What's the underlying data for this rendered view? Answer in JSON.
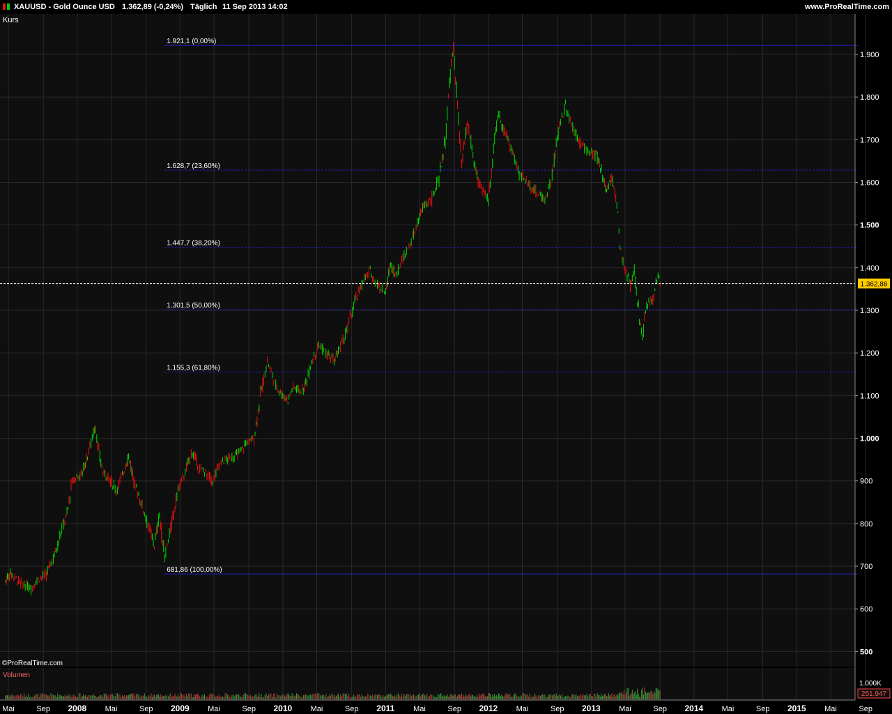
{
  "header": {
    "symbol": "XAUUSD - Gold Ounce USD",
    "quote": "1.362,89 (-0,24%)",
    "period": "Täglich",
    "datetime": "11 Sep 2013 14:02",
    "site": "www.ProRealTime.com"
  },
  "panels": {
    "price_label": "Kurs",
    "watermark": "©ProRealTime.com",
    "volume_label": "Volumen"
  },
  "current_price": {
    "value": 1362.86,
    "label": "1.362,86"
  },
  "colors": {
    "up": "#00dd00",
    "down": "#ee1111",
    "fib": "#2222cc",
    "bg": "#0f0f0f",
    "grid": "#2a2a2a",
    "current_bg": "#ffcc00"
  },
  "chart_data": [
    {
      "type": "line",
      "y_ticks": [
        {
          "v": 500,
          "label": "500"
        },
        {
          "v": 600,
          "label": "600"
        },
        {
          "v": 700,
          "label": "700"
        },
        {
          "v": 800,
          "label": "800"
        },
        {
          "v": 900,
          "label": "900"
        },
        {
          "v": 1000,
          "label": "1.000"
        },
        {
          "v": 1100,
          "label": "1.100"
        },
        {
          "v": 1200,
          "label": "1.200"
        },
        {
          "v": 1300,
          "label": "1.300"
        },
        {
          "v": 1400,
          "label": "1.400"
        },
        {
          "v": 1500,
          "label": "1.500"
        },
        {
          "v": 1600,
          "label": "1.600"
        },
        {
          "v": 1700,
          "label": "1.700"
        },
        {
          "v": 1800,
          "label": "1.800"
        },
        {
          "v": 1900,
          "label": "1.900"
        }
      ],
      "x_ticks": [
        {
          "t": 2007.33,
          "label": "Mai"
        },
        {
          "t": 2007.67,
          "label": "Sep"
        },
        {
          "t": 2008.0,
          "label": "2008"
        },
        {
          "t": 2008.33,
          "label": "Mai"
        },
        {
          "t": 2008.67,
          "label": "Sep"
        },
        {
          "t": 2009.0,
          "label": "2009"
        },
        {
          "t": 2009.33,
          "label": "Mai"
        },
        {
          "t": 2009.67,
          "label": "Sep"
        },
        {
          "t": 2010.0,
          "label": "2010"
        },
        {
          "t": 2010.33,
          "label": "Mai"
        },
        {
          "t": 2010.67,
          "label": "Sep"
        },
        {
          "t": 2011.0,
          "label": "2011"
        },
        {
          "t": 2011.33,
          "label": "Mai"
        },
        {
          "t": 2011.67,
          "label": "Sep"
        },
        {
          "t": 2012.0,
          "label": "2012"
        },
        {
          "t": 2012.33,
          "label": "Mai"
        },
        {
          "t": 2012.67,
          "label": "Sep"
        },
        {
          "t": 2013.0,
          "label": "2013"
        },
        {
          "t": 2013.33,
          "label": "Mai"
        },
        {
          "t": 2013.67,
          "label": "Sep"
        },
        {
          "t": 2014.0,
          "label": "2014"
        },
        {
          "t": 2014.33,
          "label": "Mai"
        },
        {
          "t": 2014.67,
          "label": "Sep"
        },
        {
          "t": 2015.0,
          "label": "2015"
        },
        {
          "t": 2015.33,
          "label": "Mai"
        },
        {
          "t": 2015.67,
          "label": "Sep"
        }
      ],
      "fib_levels": [
        {
          "v": 1921.1,
          "label": "1.921,1 (0,00%)",
          "style": "solid"
        },
        {
          "v": 1628.7,
          "label": "1.628,7 (23,60%)",
          "style": "dashed"
        },
        {
          "v": 1447.7,
          "label": "1.447,7 (38,20%)",
          "style": "dashed"
        },
        {
          "v": 1301.5,
          "label": "1.301,5 (50,00%)",
          "style": "dashed"
        },
        {
          "v": 1155.3,
          "label": "1.155,3 (61,80%)",
          "style": "dashed"
        },
        {
          "v": 681.86,
          "label": "681,86 (100,00%)",
          "style": "solid"
        }
      ],
      "fib_start": 2008.85,
      "fib_end": 2015.6,
      "series": [
        {
          "x": [
            2007.3,
            2007.35,
            2007.45,
            2007.55,
            2007.62,
            2007.7,
            2007.8,
            2007.85,
            2007.9,
            2007.95,
            2008.05,
            2008.1,
            2008.18,
            2008.2,
            2008.25,
            2008.3,
            2008.38,
            2008.45,
            2008.5,
            2008.55,
            2008.62,
            2008.7,
            2008.75,
            2008.8,
            2008.85,
            2008.92,
            2008.98,
            2009.05,
            2009.12,
            2009.18,
            2009.25,
            2009.32,
            2009.38,
            2009.45,
            2009.55,
            2009.65,
            2009.72,
            2009.78,
            2009.85,
            2009.92,
            2010.0,
            2010.05,
            2010.1,
            2010.2,
            2010.28,
            2010.35,
            2010.42,
            2010.5,
            2010.55,
            2010.62,
            2010.7,
            2010.78,
            2010.85,
            2010.92,
            2011.0,
            2011.05,
            2011.1,
            2011.18,
            2011.25,
            2011.32,
            2011.38,
            2011.45,
            2011.52,
            2011.58,
            2011.64,
            2011.66,
            2011.7,
            2011.74,
            2011.8,
            2011.85,
            2011.9,
            2011.95,
            2012.0,
            2012.06,
            2012.1,
            2012.16,
            2012.22,
            2012.3,
            2012.38,
            2012.45,
            2012.55,
            2012.62,
            2012.68,
            2012.75,
            2012.82,
            2012.9,
            2012.98,
            2013.05,
            2013.1,
            2013.15,
            2013.2,
            2013.25,
            2013.28,
            2013.3,
            2013.33,
            2013.38,
            2013.42,
            2013.47,
            2013.5,
            2013.53,
            2013.57,
            2013.6,
            2013.65,
            2013.68
          ],
          "y": [
            665,
            685,
            660,
            648,
            670,
            680,
            740,
            790,
            820,
            900,
            920,
            960,
            1030,
            980,
            920,
            910,
            880,
            920,
            960,
            900,
            850,
            790,
            750,
            820,
            720,
            800,
            880,
            920,
            970,
            930,
            920,
            900,
            940,
            950,
            960,
            990,
            1000,
            1100,
            1180,
            1130,
            1100,
            1090,
            1120,
            1110,
            1180,
            1220,
            1200,
            1180,
            1210,
            1250,
            1320,
            1370,
            1390,
            1360,
            1340,
            1410,
            1380,
            1430,
            1460,
            1510,
            1550,
            1560,
            1610,
            1700,
            1880,
            1910,
            1780,
            1640,
            1740,
            1660,
            1600,
            1580,
            1560,
            1700,
            1760,
            1720,
            1680,
            1620,
            1600,
            1580,
            1560,
            1610,
            1720,
            1780,
            1730,
            1690,
            1670,
            1660,
            1630,
            1580,
            1610,
            1560,
            1450,
            1420,
            1400,
            1360,
            1390,
            1280,
            1230,
            1300,
            1320,
            1330,
            1380,
            1362
          ]
        }
      ],
      "volume": {
        "label": "Volumen",
        "y_labels": [
          "1.000K",
          "251.947"
        ]
      }
    }
  ]
}
